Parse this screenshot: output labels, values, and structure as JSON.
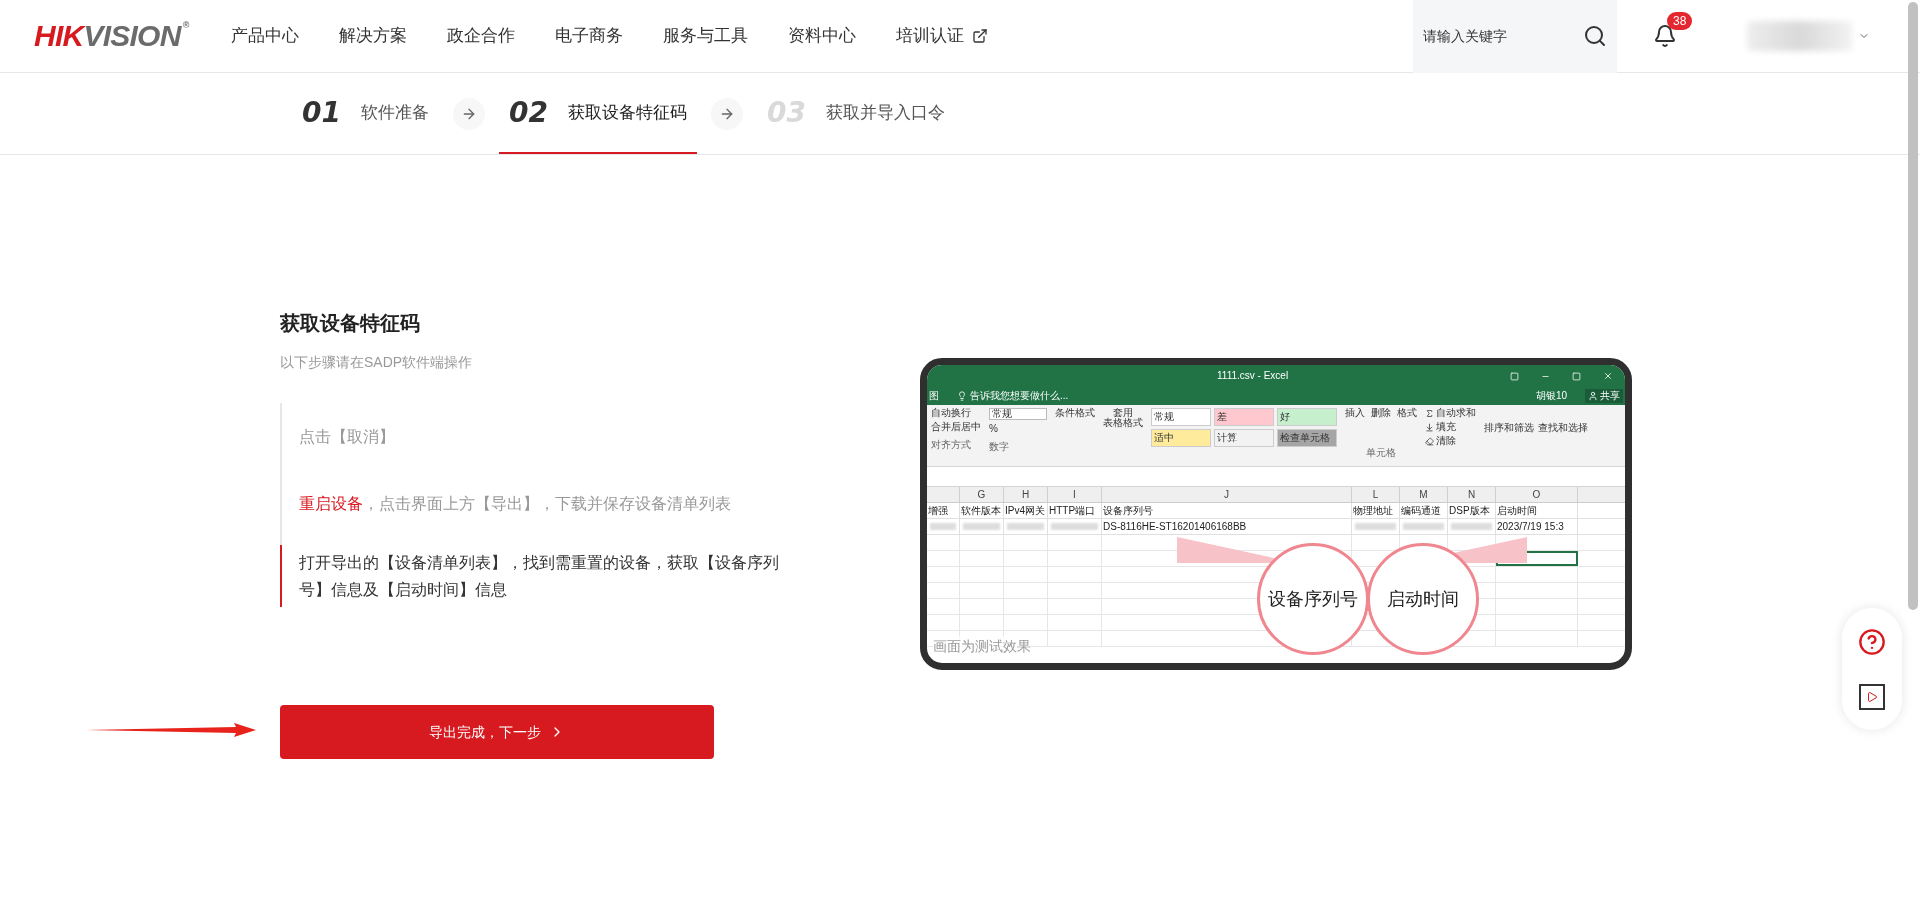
{
  "header": {
    "logo": {
      "main": "HIK",
      "rest": "VISION",
      "mark": "®"
    },
    "nav": [
      {
        "label": "产品中心",
        "external": false
      },
      {
        "label": "解决方案",
        "external": false
      },
      {
        "label": "政企合作",
        "external": false
      },
      {
        "label": "电子商务",
        "external": false
      },
      {
        "label": "服务与工具",
        "external": false
      },
      {
        "label": "资料中心",
        "external": false
      },
      {
        "label": "培训认证",
        "external": true
      }
    ],
    "search": {
      "placeholder": "请输入关键字"
    },
    "notifications": {
      "count": "38"
    }
  },
  "steps": [
    {
      "number": "01",
      "label": "软件准备",
      "selected": false,
      "upcoming": false
    },
    {
      "number": "02",
      "label": "获取设备特征码",
      "selected": true,
      "upcoming": false
    },
    {
      "number": "03",
      "label": "获取并导入口令",
      "selected": false,
      "upcoming": true
    }
  ],
  "content": {
    "title": "获取设备特征码",
    "subtitle": "以下步骤请在SADP软件端操作",
    "instructions": [
      {
        "text": "点击【取消】",
        "active": false
      },
      {
        "highlight": "重启设备",
        "text": "，点击界面上方【导出】，下载并保存设备清单列表",
        "active": false
      },
      {
        "text": "打开导出的【设备清单列表】，找到需重置的设备，获取【设备序列号】信息及【启动时间】信息",
        "active": true
      }
    ],
    "next_button": "导出完成，下一步"
  },
  "preview": {
    "window_title": "1111.csv - Excel",
    "tab_cut": "图",
    "tell_me": "告诉我您想要做什么...",
    "user": "胡银10",
    "share": "共享",
    "ribbon": {
      "wrap": "自动换行",
      "merge": "合并后居中",
      "align_group": "对齐方式",
      "format_select": "常规",
      "percent": "%",
      "number_group": "数字",
      "conditional": "条件格式",
      "table_format_1": "套用",
      "table_format_2": "表格格式",
      "styles": [
        {
          "label": "常规",
          "color": "#ffffff"
        },
        {
          "label": "差",
          "color": "#ffc7ce"
        },
        {
          "label": "好",
          "color": "#c6efce"
        },
        {
          "label": "适中",
          "color": "#ffeb9c"
        },
        {
          "label": "计算",
          "color": "#f2f2f2"
        },
        {
          "label": "检查单元格",
          "color": "#a5a5a5"
        }
      ],
      "insert": "插入",
      "delete": "删除",
      "format": "格式",
      "cells_group": "单元格",
      "autosum": "自动求和",
      "fill": "填充",
      "clear": "清除",
      "sort": "排序和筛选",
      "find": "查找和选择"
    },
    "columns": [
      {
        "header": "增强"
      },
      {
        "letter": "G",
        "header": "软件版本"
      },
      {
        "letter": "H",
        "header": "IPv4网关"
      },
      {
        "letter": "I",
        "header": "HTTP端口"
      },
      {
        "letter": "J",
        "header": "设备序列号",
        "value": "DS-8116HE-ST16201406168BB"
      },
      {
        "letter": "L",
        "header": "物理地址"
      },
      {
        "letter": "M",
        "header": "编码通道"
      },
      {
        "letter": "N",
        "header": "DSP版本"
      },
      {
        "letter": "O",
        "header": "启动时间",
        "value": "2023/7/19 15:3"
      }
    ],
    "callouts": [
      "设备序列号",
      "启动时间"
    ],
    "caption": "画面为测试效果"
  }
}
